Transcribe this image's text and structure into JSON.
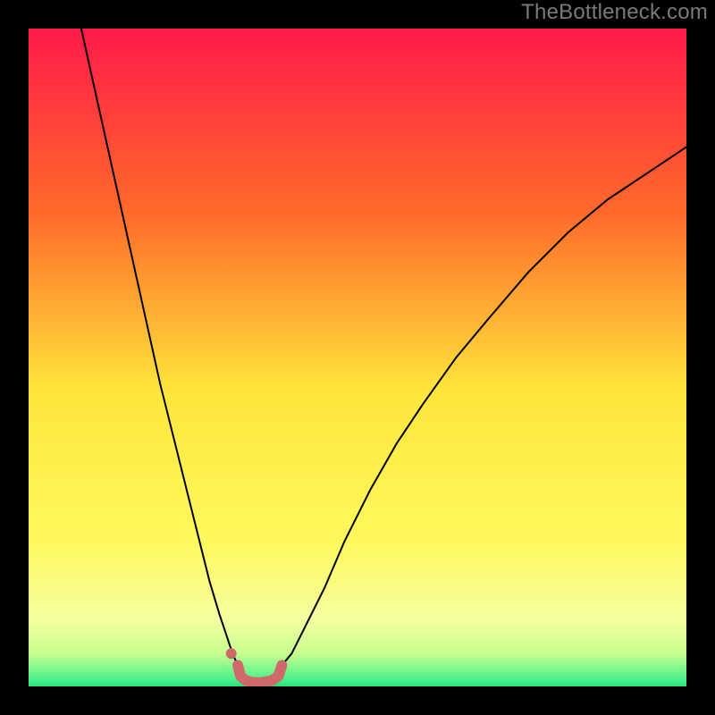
{
  "watermark": "TheBottleneck.com",
  "chart_data": {
    "type": "line",
    "title": "",
    "xlabel": "",
    "ylabel": "",
    "xlim": [
      0,
      100
    ],
    "ylim": [
      0,
      100
    ],
    "grid": false,
    "legend": false,
    "annotations": [],
    "gradient_colors": {
      "top": "#ff1a4a",
      "mid_upper": "#ff8a2a",
      "mid": "#ffe53b",
      "lower": "#f7ff66",
      "band": "#d6ff7a",
      "bottom": "#20e57a"
    },
    "series": [
      {
        "name": "left-curve",
        "stroke": "#000000",
        "stroke_width": 2,
        "x": [
          8,
          10,
          12,
          14,
          16,
          18,
          20,
          22,
          24,
          26,
          27.5,
          29,
          30,
          31,
          31.8
        ],
        "y": [
          100,
          91,
          82,
          73,
          64,
          55,
          46,
          38,
          30,
          22,
          16,
          11,
          8,
          5,
          3.2
        ]
      },
      {
        "name": "right-curve",
        "stroke": "#000000",
        "stroke_width": 2,
        "x": [
          38.5,
          40,
          42,
          45,
          48,
          52,
          56,
          60,
          65,
          70,
          76,
          82,
          88,
          94,
          100
        ],
        "y": [
          3.2,
          5,
          9,
          15,
          22,
          30,
          37,
          43,
          50,
          56,
          63,
          69,
          74,
          78,
          82
        ]
      },
      {
        "name": "pink-valley-marker",
        "stroke": "#d06a6a",
        "stroke_width": 12,
        "x": [
          31.8,
          32.2,
          33,
          34,
          35.5,
          37,
          38,
          38.5
        ],
        "y": [
          3.2,
          1.6,
          0.9,
          0.6,
          0.6,
          0.9,
          1.6,
          3.2
        ]
      }
    ],
    "points": [
      {
        "name": "pink-dot",
        "x": 30.8,
        "y": 5.0,
        "r": 6,
        "fill": "#d06a6a"
      }
    ]
  }
}
